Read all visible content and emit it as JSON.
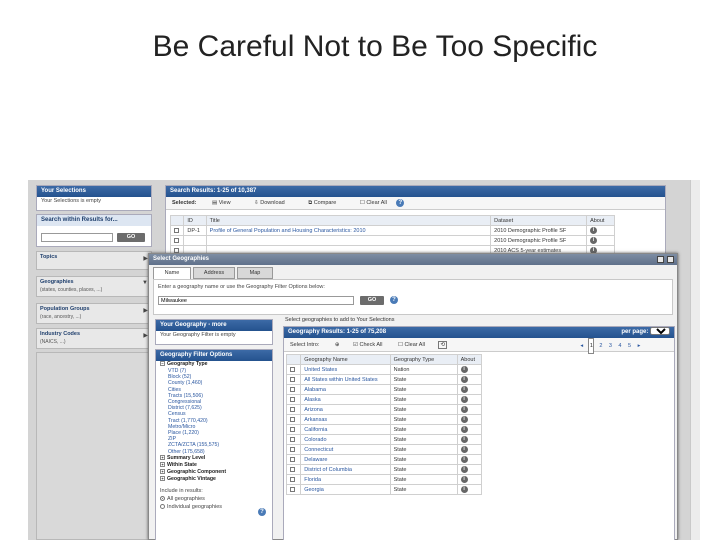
{
  "slide": {
    "title": "Be Careful Not to Be Too Specific"
  },
  "sidebar": {
    "your_selections": "Your Selections",
    "selection_empty": "Your Selections is empty",
    "search_within": "Search within Results for...",
    "go_label": "GO",
    "items": [
      {
        "label": "Topics",
        "sub": ""
      },
      {
        "label": "Geographies",
        "sub": "(states, counties, places, ...)"
      },
      {
        "label": "Population Groups",
        "sub": "(race, ancestry, ...)"
      },
      {
        "label": "Industry Codes",
        "sub": "(NAICS, ...)"
      }
    ]
  },
  "search_results": {
    "title": "Search Results: 1-25 of 10,387",
    "selected_label": "Selected:",
    "actions": [
      "View",
      "Download",
      "Compare",
      "Clear All"
    ],
    "columns": [
      "ID",
      "Title",
      "Dataset",
      "About"
    ],
    "rows": [
      {
        "id": "DP-1",
        "title": "Profile of General Population and Housing Characteristics: 2010",
        "dataset": "2010 Demographic Profile SF"
      },
      {
        "id": "",
        "title": "",
        "dataset": "2010 Demographic Profile SF"
      },
      {
        "id": "",
        "title": "",
        "dataset": "2010 ACS 5-year estimates"
      }
    ]
  },
  "dialog": {
    "title": "Select Geographies",
    "tabs": [
      "Name",
      "Address",
      "Map"
    ],
    "prompt": "Enter a geography name or use the Geography Filter Options below:",
    "search_value": "Milwaukee",
    "go_label": "GO",
    "your_geography": "Your Geography - more",
    "geo_empty": "Your Geography Filter is empty",
    "filter_options": "Geography Filter Options",
    "geography_type": "Geography Type",
    "types": [
      "VTD (7)",
      "Block (52)",
      "County (1,460)",
      "Cities",
      "Tracts (15,506)",
      "Congressional",
      "District (7,625)",
      "Census",
      "Tract (1,770,420)",
      "Metro/Micro",
      "Place (1,220)",
      "ZIP",
      "ZCTA/ZCTA (155,575)",
      "Other (175,658)"
    ],
    "expanders": [
      "Summary Level",
      "Within State",
      "Geographic Component",
      "Geographic Vintage"
    ],
    "include_label": "Include in results:",
    "radio_options": [
      "All geographies",
      "Individual geographies"
    ],
    "results_header": "Geography Results: 1-25 of 75,208",
    "select_label": "Select Intro:",
    "check_all": "Check All",
    "clear_all": "Clear All",
    "per_page_label": "per page:",
    "per_page_value": "25",
    "pages": [
      "1",
      "2",
      "3",
      "4",
      "5"
    ],
    "results_prompt": "Select geographies to add to Your Selections",
    "geo_columns": [
      "Geography Name",
      "Geography Type",
      "About"
    ],
    "geo_rows": [
      {
        "name": "United States",
        "type": "Nation"
      },
      {
        "name": "All States within United States",
        "type": "State"
      },
      {
        "name": "Alabama",
        "type": "State"
      },
      {
        "name": "Alaska",
        "type": "State"
      },
      {
        "name": "Arizona",
        "type": "State"
      },
      {
        "name": "Arkansas",
        "type": "State"
      },
      {
        "name": "California",
        "type": "State"
      },
      {
        "name": "Colorado",
        "type": "State"
      },
      {
        "name": "Connecticut",
        "type": "State"
      },
      {
        "name": "Delaware",
        "type": "State"
      },
      {
        "name": "District of Columbia",
        "type": "State"
      },
      {
        "name": "Florida",
        "type": "State"
      },
      {
        "name": "Georgia",
        "type": "State"
      }
    ]
  }
}
